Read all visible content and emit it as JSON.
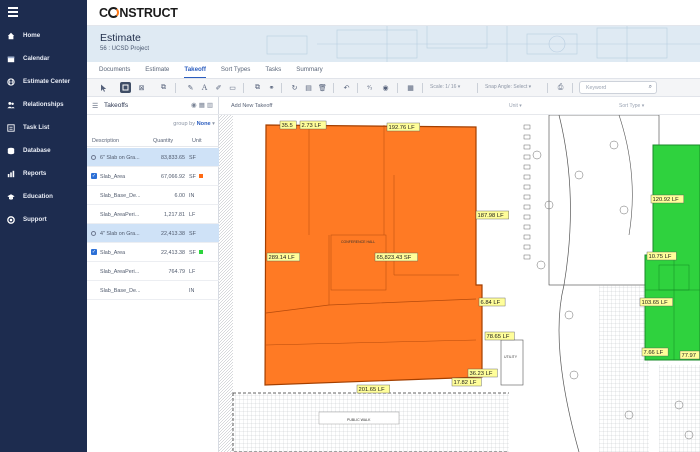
{
  "sidebar": {
    "items": [
      {
        "label": "Home",
        "icon": "home-icon"
      },
      {
        "label": "Calendar",
        "icon": "calendar-icon"
      },
      {
        "label": "Estimate Center",
        "icon": "globe-icon"
      },
      {
        "label": "Relationships",
        "icon": "people-icon"
      },
      {
        "label": "Task List",
        "icon": "list-icon"
      },
      {
        "label": "Database",
        "icon": "database-icon"
      },
      {
        "label": "Reports",
        "icon": "reports-icon"
      },
      {
        "label": "Education",
        "icon": "education-icon"
      },
      {
        "label": "Support",
        "icon": "support-icon"
      }
    ]
  },
  "brand": {
    "pre": "C",
    "post": "NSTRUCT"
  },
  "header": {
    "title": "Estimate",
    "subtitle": "56 : UCSD Project"
  },
  "tabs": [
    "Documents",
    "Estimate",
    "Takeoff",
    "Sort Types",
    "Tasks",
    "Summary"
  ],
  "active_tab": "Takeoff",
  "toolbar": {
    "scale_label": "Scale: 1/ 16",
    "snap_label": "Snap Angle: Select",
    "keyword_placeholder": "Keyword"
  },
  "panel": {
    "title": "Takeoffs",
    "group_by_label": "group by",
    "group_by_value": "None",
    "columns": {
      "description": "Description",
      "quantity": "Quantity",
      "unit": "Unit"
    },
    "rows": [
      {
        "description": "6\" Slab on Gra...",
        "quantity": "83,833.65",
        "unit": "SF",
        "group": true
      },
      {
        "description": "Slab_Area",
        "quantity": "67,066.92",
        "unit": "SF",
        "checked": true,
        "swatch": "#ff6a13"
      },
      {
        "description": "Slab_Base_De...",
        "quantity": "6.00",
        "unit": "IN"
      },
      {
        "description": "Slab_AreaPeri...",
        "quantity": "1,217.81",
        "unit": "LF"
      },
      {
        "description": "4\" Slab on Gra...",
        "quantity": "22,413.38",
        "unit": "SF",
        "group": true
      },
      {
        "description": "Slab_Area",
        "quantity": "22,413.38",
        "unit": "SF",
        "checked": true,
        "swatch": "#2bd43c"
      },
      {
        "description": "Slab_AreaPeri...",
        "quantity": "764.79",
        "unit": "LF"
      },
      {
        "description": "Slab_Base_De...",
        "quantity": "",
        "unit": "IN"
      }
    ]
  },
  "canvas": {
    "add_label": "Add New Takeoff",
    "unit_label": "Unit",
    "sort_type_label": "Sort Type",
    "orange_labels": [
      "35.5",
      "2.73 LF",
      "192.76 LF",
      "187.98 LF",
      "289.14 LF",
      "65,823.43 SF",
      "6.84 LF",
      "78.65 LF",
      "36.23 LF",
      "17.82 LF",
      "201.65 LF"
    ],
    "green_labels": [
      "120.92 LF",
      "10.75 LF",
      "103.65 LF",
      "7.66 LF",
      "77.97"
    ],
    "room_labels": [
      "UTILITY",
      "PUBLIC WALK",
      "CONFERENCE HALL"
    ],
    "colors": {
      "orange": "#ff7a24",
      "green": "#2fd23e"
    }
  }
}
